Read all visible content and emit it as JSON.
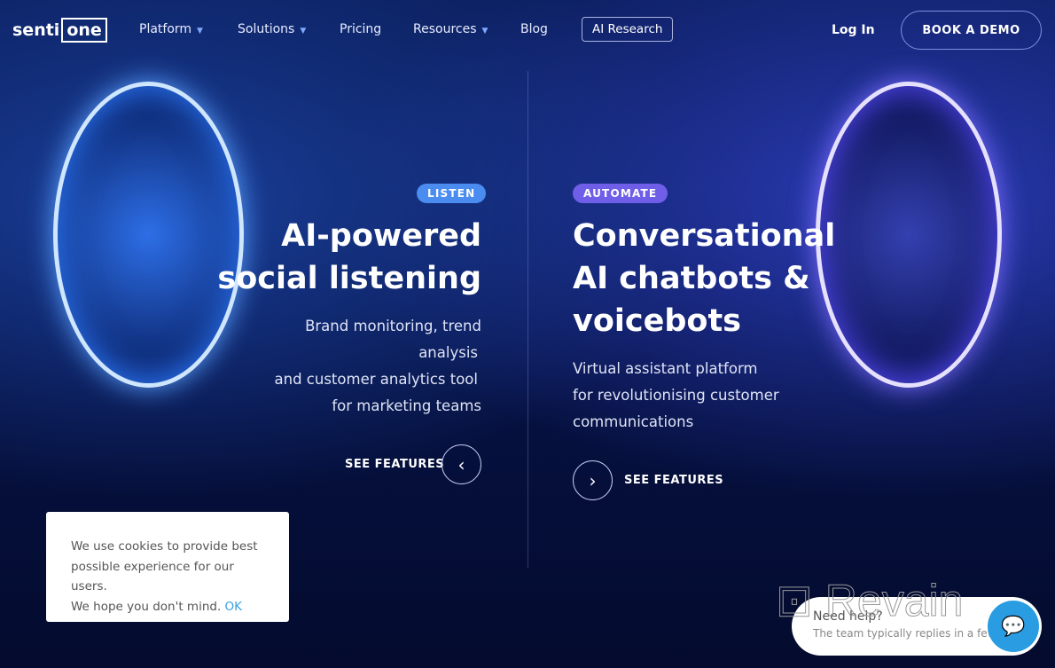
{
  "nav": {
    "logo_left": "senti",
    "logo_right": "one",
    "items": [
      {
        "label": "Platform",
        "dropdown": true
      },
      {
        "label": "Solutions",
        "dropdown": true
      },
      {
        "label": "Pricing"
      },
      {
        "label": "Resources",
        "dropdown": true
      },
      {
        "label": "Blog"
      }
    ],
    "ai_research": "AI Research",
    "login": "Log In",
    "demo": "BOOK A DEMO"
  },
  "listen": {
    "tag": "LISTEN",
    "tag_color": "#4a8cf0",
    "title1": "AI-powered",
    "title2": "social listening",
    "sub": [
      "Brand monitoring, trend",
      "analysis",
      "and customer analytics tool",
      "for marketing teams"
    ],
    "cta": "SEE FEATURES",
    "cta_icon": "chevron-left"
  },
  "automate": {
    "tag": "AUTOMATE",
    "tag_color": "#6f5ee8",
    "title": [
      "Conversational",
      "AI chatbots &",
      "voicebots"
    ],
    "sub": [
      "Virtual assistant platform",
      "for revolutionising customer",
      "communications"
    ],
    "cta": "SEE FEATURES",
    "cta_icon": "chevron-right"
  },
  "cookie": {
    "text1": "We use cookies to provide best",
    "text2": "possible experience for our users.",
    "text3": "We hope you don't mind.",
    "ok": "OK"
  },
  "chat": {
    "title": "Need help?",
    "subtitle": "The team typically replies in a few",
    "accent": "#2a9ce2"
  },
  "watermark": "Revain"
}
